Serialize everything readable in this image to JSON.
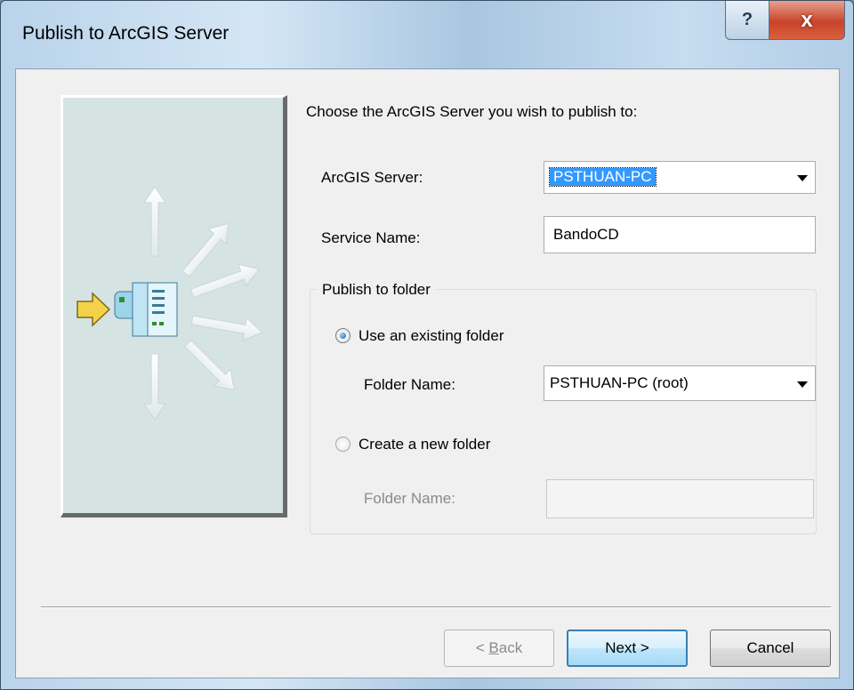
{
  "window": {
    "title": "Publish to ArcGIS Server"
  },
  "titlebar": {
    "help_glyph": "?",
    "close_glyph": "x"
  },
  "prompt": "Choose the ArcGIS Server you wish to publish to:",
  "server": {
    "label": "ArcGIS Server:",
    "value": "PSTHUAN-PC"
  },
  "service": {
    "label": "Service Name:",
    "value": "BandoCD"
  },
  "publish_folder": {
    "legend": "Publish to folder",
    "existing": {
      "label": "Use an existing folder",
      "selected": true,
      "folder_label": "Folder Name:",
      "folder_value": "PSTHUAN-PC (root)"
    },
    "create": {
      "label": "Create a new folder",
      "selected": false,
      "folder_label": "Folder Name:",
      "folder_value": ""
    }
  },
  "buttons": {
    "back_prefix": "< ",
    "back_accel": "B",
    "back_rest": "ack",
    "next": "Next >",
    "cancel": "Cancel"
  },
  "icons": {
    "illustration": "server-publish-illustration-icon",
    "accent": "#3399ff"
  }
}
